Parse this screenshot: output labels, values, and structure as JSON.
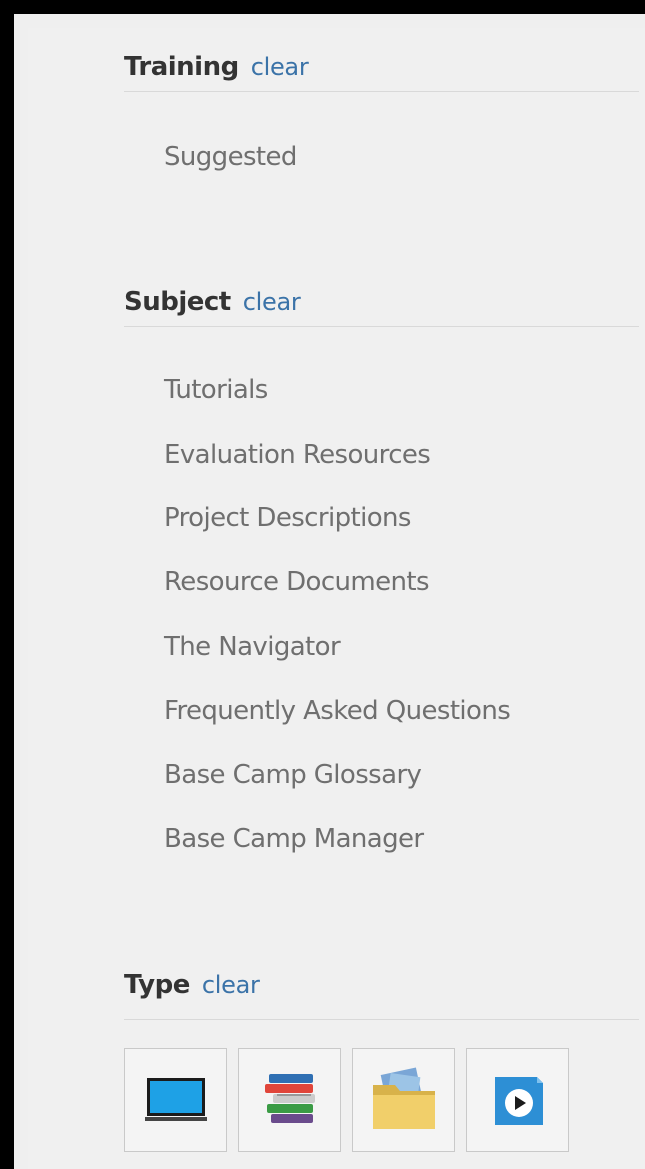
{
  "filters": {
    "training": {
      "title": "Training",
      "clear_label": "clear",
      "items": [
        "Suggested"
      ]
    },
    "subject": {
      "title": "Subject",
      "clear_label": "clear",
      "items": [
        "Tutorials",
        "Evaluation Resources",
        "Project Descriptions",
        "Resource Documents",
        "The Navigator",
        "Frequently Asked Questions",
        "Base Camp Glossary",
        "Base Camp Manager"
      ]
    },
    "type": {
      "title": "Type",
      "clear_label": "clear",
      "buttons": [
        {
          "icon": "monitor-icon"
        },
        {
          "icon": "books-icon"
        },
        {
          "icon": "folder-icon"
        },
        {
          "icon": "video-play-icon"
        }
      ]
    }
  },
  "colors": {
    "panel_bg": "#f0f0f0",
    "frame": "#000000",
    "title_text": "#333333",
    "link": "#3b73a8",
    "item_text": "#6f6f6f",
    "divider": "#d9d9d9"
  }
}
